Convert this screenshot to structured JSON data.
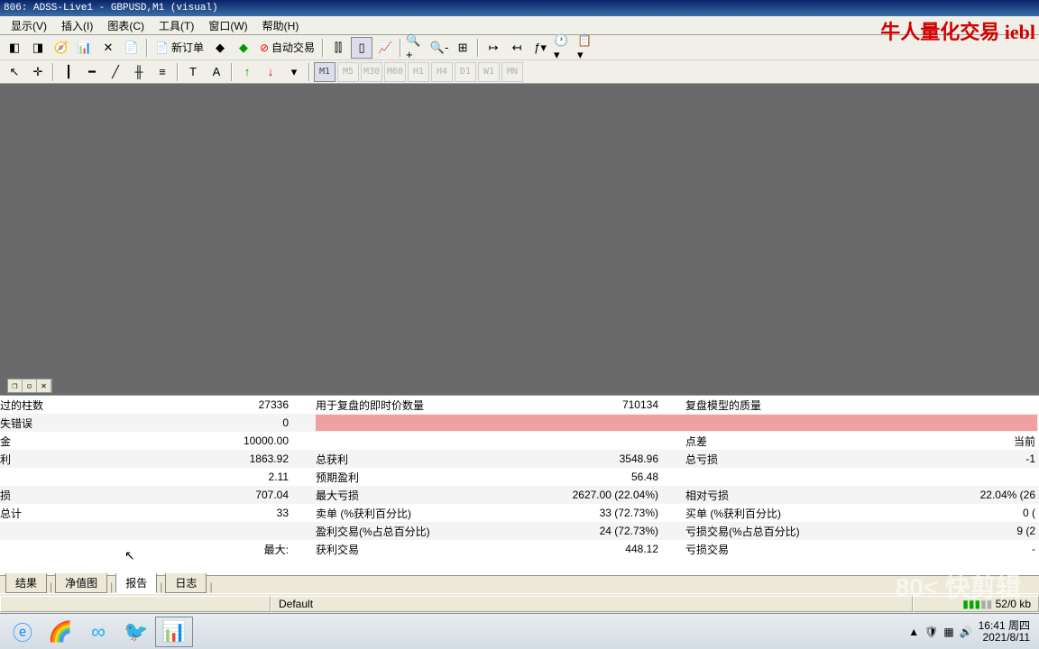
{
  "title": "806: ADSS-Live1 - GBPUSD,M1 (visual)",
  "watermark": "牛人量化交易 iebl",
  "menu": {
    "view": "显示(V)",
    "insert": "插入(I)",
    "chart": "图表(C)",
    "tools": "工具(T)",
    "window": "窗口(W)",
    "help": "帮助(H)"
  },
  "toolbar": {
    "neworder": "新订单",
    "autotrade": "自动交易"
  },
  "timeframes": {
    "m1": "M1",
    "m5": "M5",
    "m30": "M30",
    "m60": "M60",
    "h1": "H1",
    "h4": "H4",
    "d1": "D1",
    "w1": "W1",
    "mn": "MN"
  },
  "report": {
    "row1": {
      "l1": "过的柱数",
      "v1": "27336",
      "l2": "用于复盘的即时价数量",
      "v2": "710134",
      "l3": "复盘模型的质量"
    },
    "row2": {
      "l1": "失错误",
      "v1": "0"
    },
    "row3": {
      "l1": "金",
      "v1": "10000.00",
      "l3": "点差",
      "v3": "当前"
    },
    "row4": {
      "l1": "利",
      "v1": "1863.92",
      "l2": "总获利",
      "v2": "3548.96",
      "l3": "总亏损",
      "v3": "-1"
    },
    "row5": {
      "v1": "2.11",
      "l2": "预期盈利",
      "v2": "56.48"
    },
    "row6": {
      "l1": "损",
      "v1": "707.04",
      "l2": "最大亏损",
      "v2": "2627.00 (22.04%)",
      "l3": "相对亏损",
      "v3": "22.04% (26"
    },
    "row7": {
      "l1": "总计",
      "v1": "33",
      "l2": "卖单 (%获利百分比)",
      "v2": "33 (72.73%)",
      "l3": "买单 (%获利百分比)",
      "v3": "0 ("
    },
    "row8": {
      "l2": "盈利交易(%占总百分比)",
      "v2": "24 (72.73%)",
      "l3": "亏损交易(%占总百分比)",
      "v3": "9 (2"
    },
    "row9": {
      "v1": "最大:",
      "l2": "获利交易",
      "v2": "448.12",
      "l3": "亏损交易",
      "v3": "-"
    }
  },
  "tabs": {
    "results": "结果",
    "equity": "净值图",
    "report": "报告",
    "log": "日志"
  },
  "statusbar": {
    "default": "Default",
    "conn": "52/0 kb"
  },
  "tray": {
    "time": "16:41 周四",
    "date": "2021/8/11"
  },
  "overlay": "80< 快剪辑"
}
